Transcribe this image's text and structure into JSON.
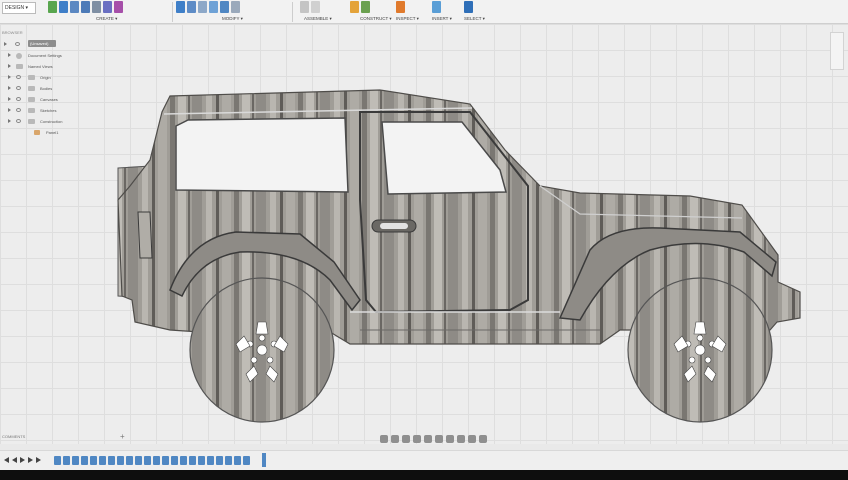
{
  "app": {
    "workspace_label": "DESIGN ▾"
  },
  "toolbar": {
    "groups": [
      {
        "label": "CREATE ▾"
      },
      {
        "label": "MODIFY ▾"
      },
      {
        "label": "ASSEMBLE ▾"
      },
      {
        "label": "CONSTRUCT ▾"
      },
      {
        "label": "INSPECT ▾"
      },
      {
        "label": "INSERT ▾"
      },
      {
        "label": "SELECT ▾"
      }
    ]
  },
  "browser": {
    "title": "BROWSER",
    "root": "(Unsaved)",
    "items": [
      {
        "label": "Document Settings"
      },
      {
        "label": "Named Views"
      },
      {
        "label": "Origin"
      },
      {
        "label": "Bodies"
      },
      {
        "label": "Canvases"
      },
      {
        "label": "Sketches"
      },
      {
        "label": "Construction"
      },
      {
        "label": "Panel1"
      }
    ]
  },
  "comments": {
    "label": "COMMENTS",
    "add": "+"
  },
  "colors": {
    "grid": "#dedede",
    "canvas": "#ededed",
    "wood_light": "#a3a09a",
    "wood_dark": "#6d6a66",
    "accent_blue": "#4f87c3"
  }
}
